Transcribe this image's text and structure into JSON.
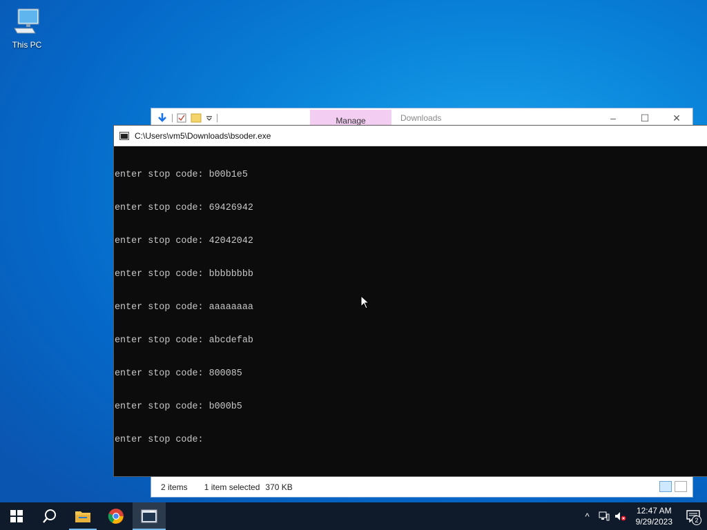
{
  "desktop": {
    "icons": [
      {
        "label": "This PC",
        "icon": "computer-icon"
      }
    ]
  },
  "explorer": {
    "manage_tab": "Manage",
    "title": "Downloads",
    "status": {
      "items": "2 items",
      "selected": "1 item selected",
      "size": "370 KB"
    },
    "controls": {
      "minimize": "–",
      "maximize": "☐",
      "close": "✕"
    }
  },
  "console": {
    "title": "C:\\Users\\vm5\\Downloads\\bsoder.exe",
    "lines": [
      "enter stop code: b00b1e5",
      "enter stop code: 69426942",
      "enter stop code: 42042042",
      "enter stop code: bbbbbbbb",
      "enter stop code: aaaaaaaa",
      "enter stop code: abcdefab",
      "enter stop code: 800085",
      "enter stop code: b000b5",
      "enter stop code: "
    ]
  },
  "taskbar": {
    "apps": [
      "start-icon",
      "search-icon",
      "file-explorer-icon",
      "chrome-icon",
      "console-app-icon"
    ],
    "clock": {
      "time": "12:47 AM",
      "date": "9/29/2023"
    },
    "notifications_count": "2",
    "tray_chevron": "^"
  },
  "colors": {
    "console_bg": "#0c0c0c",
    "console_fg": "#c8c8c8",
    "manage_tab": "#f3cdf2",
    "taskbar": "#0f1b2a"
  }
}
